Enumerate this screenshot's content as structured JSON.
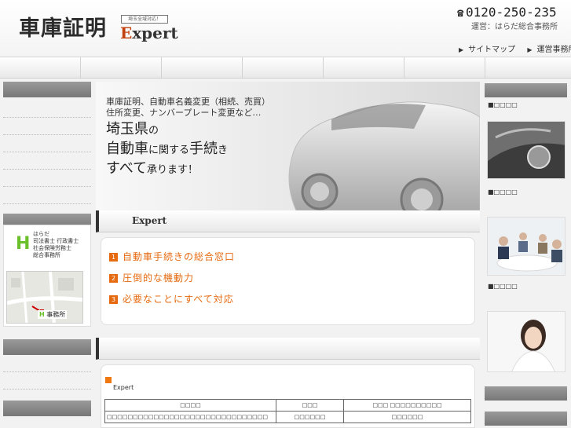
{
  "header": {
    "logo_main": "車庫証明",
    "logo_badge": "埼玉全域対応！",
    "logo_expert_e": "E",
    "logo_expert_rest": "xpert",
    "phone": "0120-250-235",
    "operator": "運営：はらだ総合事務所",
    "links": [
      "サイトマップ",
      "運営事務所"
    ]
  },
  "left": {
    "office_lines": [
      "はらだ",
      "司法書士 行政書士",
      "社会保険労務士",
      "総合事務所"
    ],
    "map_label": "事務所"
  },
  "hero": {
    "sub1": "車庫証明、自動車名義変更（相続、売買）",
    "sub2": "住所変更、ナンバープレート変更など…",
    "line1_big": "埼玉県",
    "line1_small": "の",
    "line2_big": "自動車",
    "line2_small": "に関する",
    "line2_big2": "手続",
    "line2_small2": "き",
    "line3_big": "すべて",
    "line3_small": "承ります！"
  },
  "section1": {
    "title": "Expert",
    "features": [
      {
        "num": "1",
        "text": "自動車手続きの総合窓口"
      },
      {
        "num": "2",
        "text": "圧倒的な機動力"
      },
      {
        "num": "3",
        "text": "必要なことにすべて対応"
      }
    ]
  },
  "section2": {
    "label": "Expert",
    "table": {
      "headers": [
        "□□□□",
        "□□□",
        "□□□ □□□□□□□□□□"
      ],
      "rows": [
        [
          "□□□□□□□□□□□□□□□□□□□□□□□□□□□□□□□",
          "□□□□□□",
          "□□□□□□"
        ]
      ]
    }
  },
  "right": {
    "titles": [
      "■□□□□",
      "■□□□□",
      "■□□□□"
    ]
  },
  "colors": {
    "accent_orange": "#e56a10",
    "logo_green": "#6abf2a",
    "bar_gray": "#888888"
  }
}
